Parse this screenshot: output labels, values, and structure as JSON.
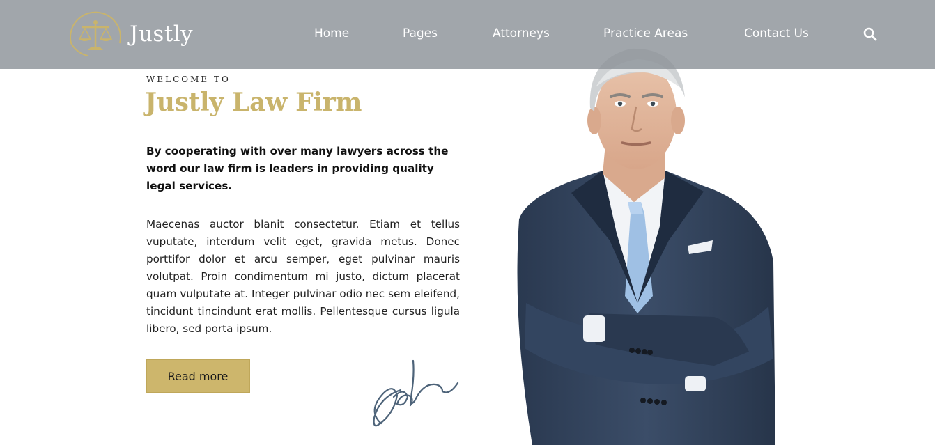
{
  "header": {
    "logo_text": "Justly",
    "nav": {
      "home": "Home",
      "pages": "Pages",
      "attorneys": "Attorneys",
      "practice_areas": "Practice Areas",
      "contact_us": "Contact Us"
    },
    "search_icon": "search-icon"
  },
  "hero": {
    "eyebrow": "WELCOME TO",
    "title": "Justly Law Firm",
    "lead": "By cooperating with over many lawyers across the word our law firm is leaders in providing quality legal services.",
    "body": "Maecenas auctor blanit consectetur. Etiam et tellus vuputate, interdum velit eget, gravida metus. Donec porttifor dolor et arcu semper, eget pulvinar mauris volutpat. Proin condimentum mi justo, dictum placerat quam vulputate at. Integer pulvinar odio nec sem eleifend, tincidunt tincindunt erat mollis. Pellentesque cursus ligula libero, sed porta ipsum.",
    "button_label": "Read more"
  },
  "colors": {
    "accent_gold": "#c9b46c",
    "header_bg": "#9ca1a6",
    "button_bg": "#cdb66c"
  }
}
